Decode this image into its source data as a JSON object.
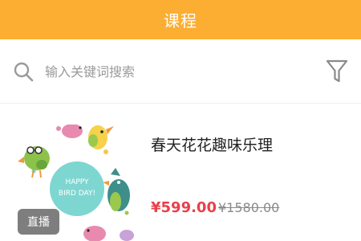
{
  "header": {
    "title": "课程"
  },
  "search": {
    "placeholder": "输入关键词搜索",
    "value": ""
  },
  "courses": [
    {
      "title": "春天花花趣味乐理",
      "badge": "直播",
      "price": "¥599.00",
      "original_price": "¥1580.00",
      "thumbnail_text": "HAPPY BIRD DAY!"
    }
  ],
  "colors": {
    "header_bg": "#FBAE32",
    "price": "#E9404A",
    "muted": "#9a9a9a"
  },
  "icons": {
    "search": "search-icon",
    "filter": "filter-icon"
  }
}
